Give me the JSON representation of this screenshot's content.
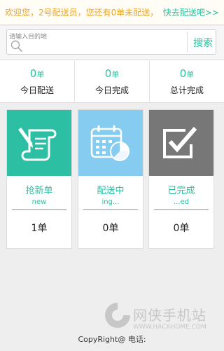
{
  "banner": {
    "message": "欢迎您，2号配送员，您还有0单未配送，",
    "link": "快去配送吧>>"
  },
  "search": {
    "placeholder": "请输入目的地",
    "button_label": "搜索"
  },
  "stats": [
    {
      "value": "0",
      "unit": "单",
      "label": "今日配送"
    },
    {
      "value": "0",
      "unit": "单",
      "label": "今日完成"
    },
    {
      "value": "0",
      "unit": "单",
      "label": "总计完成"
    }
  ],
  "cards": [
    {
      "title": "抢新单",
      "subtitle": "new",
      "count": "1单",
      "icon": "grab-order-icon",
      "color": "#2dbfa3"
    },
    {
      "title": "配送中",
      "subtitle": "ing...",
      "count": "0单",
      "icon": "calendar-pie-icon",
      "color": "#86cbf0"
    },
    {
      "title": "已完成",
      "subtitle": "...ed",
      "count": "0单",
      "icon": "checkbox-icon",
      "color": "#777777"
    }
  ],
  "footer": {
    "text": "CopyRight@ 电话:"
  },
  "watermark": {
    "text": "网侠手机站",
    "url": "WWW.HACKHOME.COM"
  },
  "colors": {
    "accent": "#2bbfa0",
    "banner_text": "#e8a62d"
  }
}
